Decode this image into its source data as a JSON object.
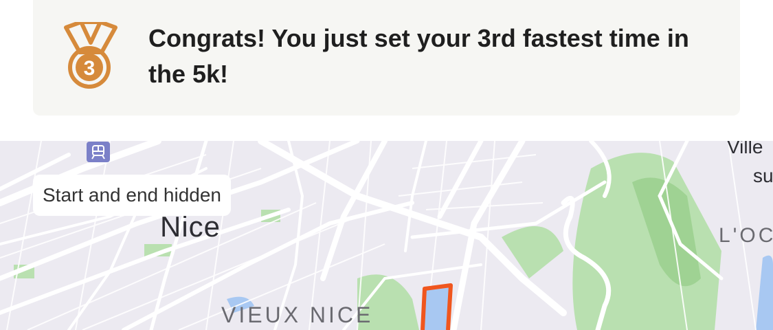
{
  "achievement": {
    "icon": "bronze-medal-3-icon",
    "rank_badge": "3",
    "message": "Congrats! You just set your 3rd fastest time in the 5k!",
    "medal_color": "#d68a3b"
  },
  "map": {
    "privacy_label": "Start and end hidden",
    "city_label": "Nice",
    "district_label": "VIEUX NICE",
    "partial_label_1": "Ville",
    "partial_label_2": "su",
    "partial_label_3": "L'OC",
    "route_color": "#f0561e",
    "park_color": "#a8d7a0",
    "water_color": "#a8c8f2",
    "road_color": "#ffffff"
  }
}
